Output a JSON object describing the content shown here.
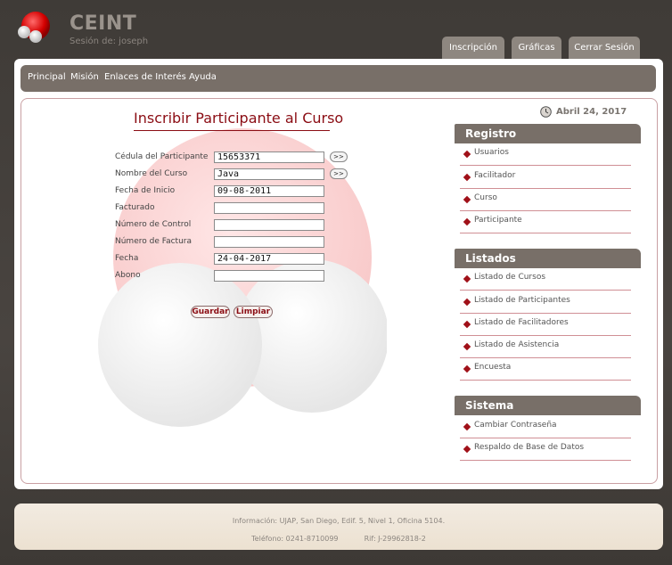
{
  "header": {
    "brand": "CEINT",
    "session": "Sesión de: joseph"
  },
  "top_tabs": [
    "Inscripción",
    "Gráficas",
    "Cerrar Sesión"
  ],
  "nav": [
    "Principal",
    "Misión",
    "Enlaces de Interés",
    "Ayuda"
  ],
  "form": {
    "title": "Inscribir Participante al Curso",
    "fields": [
      {
        "label": "Cédula del Participante",
        "value": "15653371"
      },
      {
        "label": "Nombre del Curso",
        "value": "Java"
      },
      {
        "label": "Fecha de Inicio",
        "value": "09-08-2011"
      },
      {
        "label": "Facturado",
        "value": ""
      },
      {
        "label": "Número de Control",
        "value": ""
      },
      {
        "label": "Número de Factura",
        "value": ""
      },
      {
        "label": "Fecha",
        "value": "24-04-2017"
      },
      {
        "label": "Abono",
        "value": ""
      }
    ],
    "lookup_label": ">>",
    "save_label": "Guardar",
    "clear_label": "Limpiar"
  },
  "date": "Abril 24, 2017",
  "sidebar": {
    "registro": {
      "title": "Registro",
      "items": [
        "Usuarios",
        "Facilitador",
        "Curso",
        "Participante"
      ]
    },
    "listados": {
      "title": "Listados",
      "items": [
        "Listado de Cursos",
        "Listado de Participantes",
        "Listado de Facilitadores",
        "Listado de Asistencia",
        "Encuesta"
      ]
    },
    "sistema": {
      "title": "Sistema",
      "items": [
        "Cambiar Contraseña",
        "Respaldo de Base de Datos"
      ]
    }
  },
  "footer": {
    "info": "Información: UJAP, San Diego, Edif. 5, Nivel 1, Oficina 5104.",
    "phone": "Teléfono: 0241-8710099",
    "rif": "Rif: J-29962818-2"
  },
  "colors": {
    "accent": "#8b0d14",
    "bar": "#786f68",
    "background": "#45403c"
  }
}
